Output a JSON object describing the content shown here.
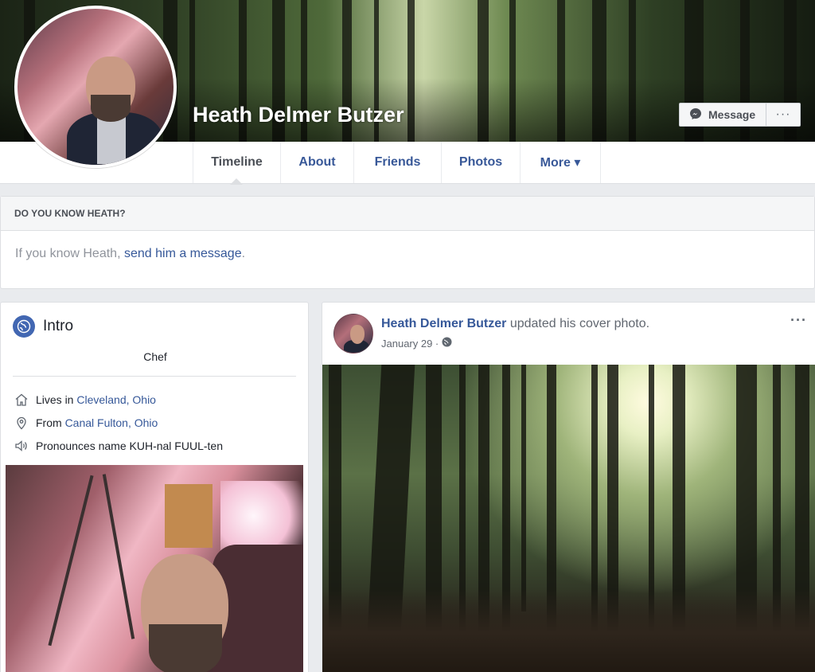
{
  "profile": {
    "name": "Heath Delmer Butzer",
    "message_label": "Message",
    "more_actions": "···"
  },
  "tabs": [
    {
      "label": "Timeline",
      "active": true
    },
    {
      "label": "About"
    },
    {
      "label": "Friends"
    },
    {
      "label": "Photos"
    },
    {
      "label": "More ▾"
    }
  ],
  "know": {
    "heading": "DO YOU KNOW HEATH?",
    "text": "If you know Heath, ",
    "link": "send him a message",
    "suffix": "."
  },
  "intro": {
    "title": "Intro",
    "bio": "Chef",
    "lives_prefix": "Lives in ",
    "lives_link": "Cleveland, Ohio",
    "from_prefix": "From ",
    "from_link": "Canal Fulton, Ohio",
    "pronounce": "Pronounces name KUH-nal FUUL-ten"
  },
  "post": {
    "author": "Heath Delmer Butzer",
    "action": " updated his cover photo.",
    "date": "January 29 ·",
    "menu": "···"
  },
  "colors": {
    "link": "#365899",
    "tab_text": "#385898",
    "accent": "#4267b2",
    "page_bg": "#e9ebee"
  },
  "icons": {
    "message": "messenger-icon",
    "globe": "globe-icon",
    "home": "home-icon",
    "pin": "location-pin-icon",
    "audio": "speaker-icon",
    "privacy": "public-globe-icon"
  }
}
